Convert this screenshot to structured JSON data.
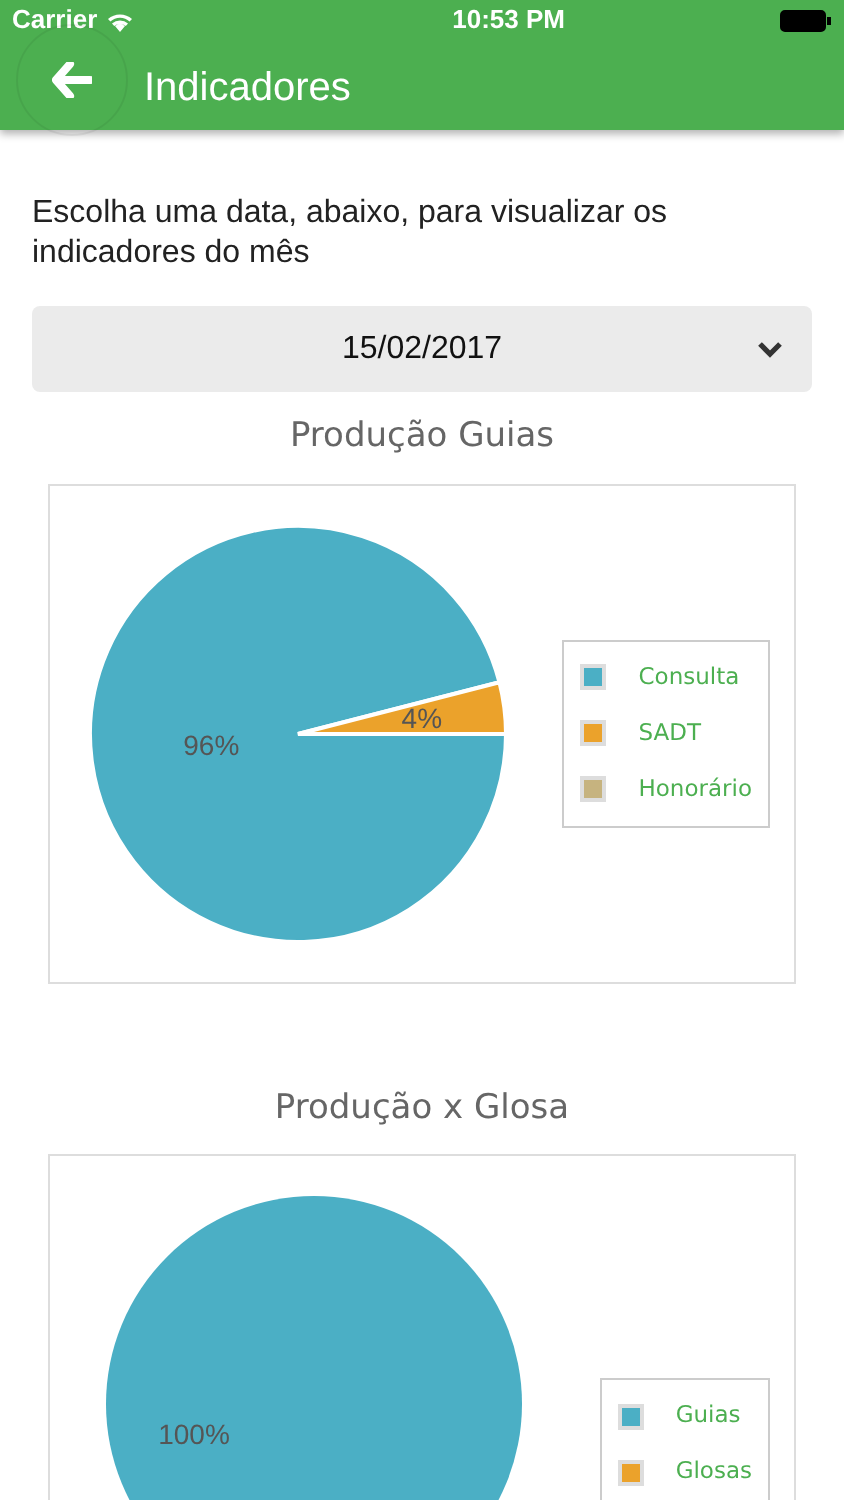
{
  "status_bar": {
    "carrier": "Carrier",
    "time": "10:53 PM"
  },
  "header": {
    "title": "Indicadores"
  },
  "intro": "Escolha uma data, abaixo, para visualizar os indicadores do mês",
  "date_select": {
    "value": "15/02/2017"
  },
  "charts": [
    {
      "chart_data": {
        "type": "pie",
        "title": "Produção Guias",
        "categories": [
          "Consulta",
          "SADT",
          "Honorário"
        ],
        "values": [
          96,
          4,
          0
        ],
        "colors": [
          "#4bafc5",
          "#eba22b",
          "#c6b37f"
        ],
        "value_labels": [
          "96%",
          "4%",
          null
        ],
        "legend": "right"
      }
    },
    {
      "chart_data": {
        "type": "pie",
        "title": "Produção x Glosa",
        "categories": [
          "Guias",
          "Glosas"
        ],
        "values": [
          100,
          0
        ],
        "colors": [
          "#4bafc5",
          "#eba22b"
        ],
        "value_labels": [
          "100%",
          null
        ],
        "legend": "right"
      }
    }
  ]
}
